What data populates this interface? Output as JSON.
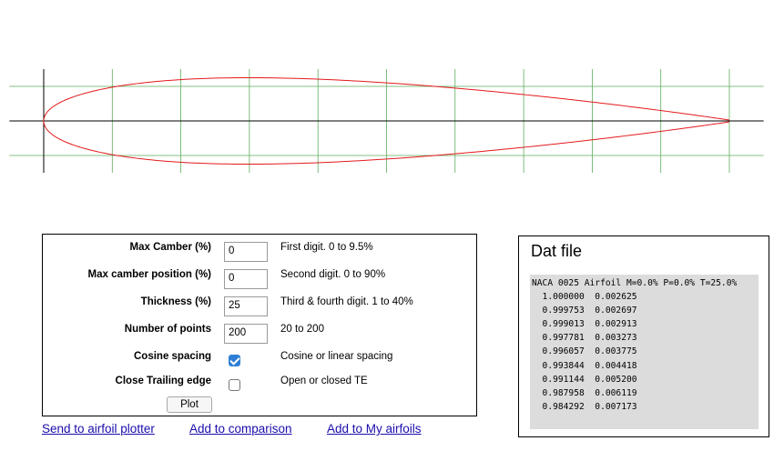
{
  "chart_data": {
    "type": "line",
    "title": "",
    "xlabel": "",
    "ylabel": "",
    "xlim": [
      -0.05,
      1.05
    ],
    "ylim": [
      -0.15,
      0.15
    ],
    "grid": true,
    "series": [
      {
        "name": "",
        "color": "#e31a1c",
        "thickness": 0.25,
        "camber": 0,
        "camber_position": 0
      }
    ]
  },
  "form": {
    "fields": [
      {
        "label": "Max Camber (%)",
        "value": "0",
        "hint": "First digit. 0 to 9.5%"
      },
      {
        "label": "Max camber position (%)",
        "value": "0",
        "hint": "Second digit. 0 to 90%"
      },
      {
        "label": "Thickness (%)",
        "value": "25",
        "hint": "Third & fourth digit. 1 to 40%"
      },
      {
        "label": "Number of points",
        "value": "200",
        "hint": "20 to 200"
      }
    ],
    "checkboxes": [
      {
        "label": "Cosine spacing",
        "checked": true,
        "hint": "Cosine or linear spacing"
      },
      {
        "label": "Close Trailing edge",
        "checked": false,
        "hint": "Open or closed TE"
      }
    ],
    "plot_label": "Plot"
  },
  "links": {
    "send": "Send to airfoil plotter",
    "compare": "Add to comparison",
    "myairfoils": "Add to My airfoils"
  },
  "dat": {
    "title": "Dat file",
    "header": "NACA 0025 Airfoil M=0.0% P=0.0% T=25.0%",
    "rows": [
      "  1.000000  0.002625",
      "  0.999753  0.002697",
      "  0.999013  0.002913",
      "  0.997781  0.003273",
      "  0.996057  0.003775",
      "  0.993844  0.004418",
      "  0.991144  0.005200",
      "  0.987958  0.006119",
      "  0.984292  0.007173"
    ]
  }
}
